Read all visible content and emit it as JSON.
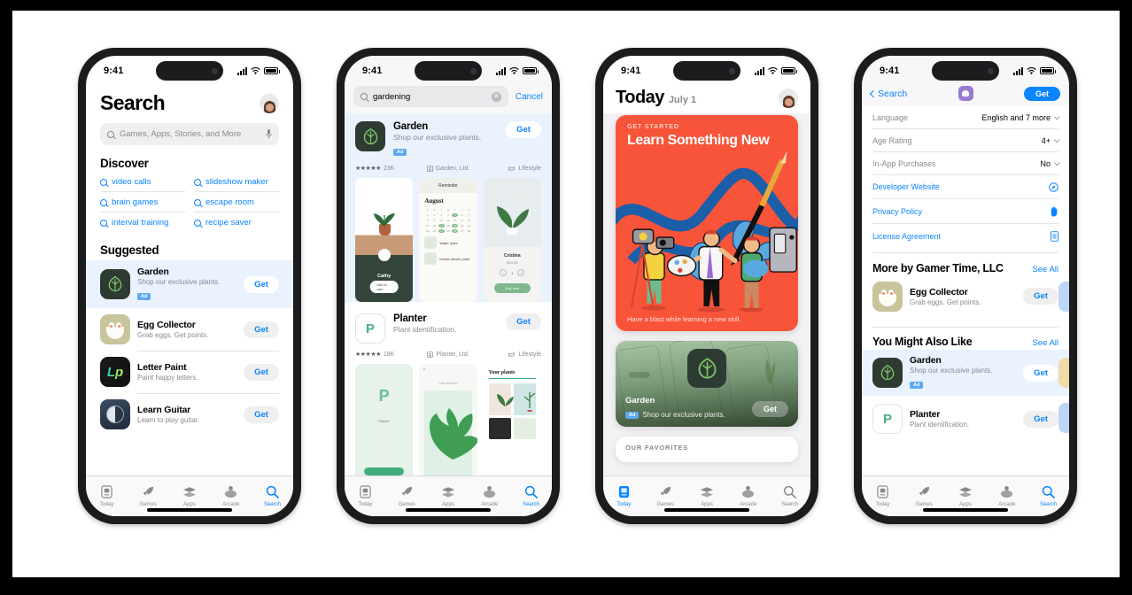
{
  "status_bar": {
    "time": "9:41"
  },
  "tabs": [
    {
      "label": "Today",
      "icon": "today-icon"
    },
    {
      "label": "Games",
      "icon": "games-icon"
    },
    {
      "label": "Apps",
      "icon": "apps-icon"
    },
    {
      "label": "Arcade",
      "icon": "arcade-icon"
    },
    {
      "label": "Search",
      "icon": "search-icon"
    }
  ],
  "colors": {
    "accent": "#0a84ff",
    "ad_badge": "#5ca9f5",
    "ad_row_bg": "#e9f2fe",
    "hero_bg": "#f8543a",
    "garden_icon_bg": "#2e3b32",
    "garden_leaf": "#7dc86a"
  },
  "phone1": {
    "title": "Search",
    "avatar": "avatar",
    "search": {
      "placeholder": "Games, Apps, Stories, and More",
      "mic_icon": "microphone-icon"
    },
    "discover": {
      "heading": "Discover",
      "items": [
        "video calls",
        "slideshow maker",
        "brain games",
        "escape room",
        "interval training",
        "recipe saver"
      ]
    },
    "suggested": {
      "heading": "Suggested",
      "apps": [
        {
          "name": "Garden",
          "subtitle": "Shop our exclusive plants.",
          "badge": "Ad",
          "action": "Get",
          "icon": "garden-icon"
        },
        {
          "name": "Egg Collector",
          "subtitle": "Grab eggs. Get points.",
          "badge": "",
          "action": "Get",
          "icon": "egg-collector-icon"
        },
        {
          "name": "Letter Paint",
          "subtitle": "Paint happy letters.",
          "badge": "",
          "action": "Get",
          "icon": "letter-paint-icon"
        },
        {
          "name": "Learn Guitar",
          "subtitle": "Learn to play guitar.",
          "badge": "",
          "action": "Get",
          "icon": "learn-guitar-icon"
        }
      ]
    }
  },
  "phone2": {
    "search": {
      "value": "gardening",
      "clear": "✕",
      "cancel": "Cancel"
    },
    "results": [
      {
        "name": "Garden",
        "subtitle": "Shop our exclusive plants.",
        "badge": "Ad",
        "action": "Get",
        "stars": "★★★★★",
        "ratings": "23K",
        "developer": "Garden, Ltd.",
        "category": "Lifestyle",
        "icon": "garden-icon"
      },
      {
        "name": "Planter",
        "subtitle": "Plant identification.",
        "badge": "",
        "action": "Get",
        "stars": "★★★★★",
        "ratings": "18K",
        "developer": "Planter, Ltd.",
        "category": "Lifestyle",
        "icon": "planter-icon"
      }
    ],
    "screenshot_captions": {
      "shot1_label": "Cathy",
      "shot1_button": "Add to cart",
      "shot2_title": "Reminder",
      "shot2_month": "August",
      "shot2_row1": "Water plant",
      "shot2_row2": "Dahlia dieses plant",
      "shot3_title": "Cristina",
      "shot3_price": "$15.99",
      "shot3_button": "Buy now",
      "shot4_title": "Your plants"
    }
  },
  "phone3": {
    "title": "Today",
    "date": "July 1",
    "avatar": "avatar",
    "hero": {
      "kicker": "GET STARTED",
      "title": "Learn Something New",
      "footer": "Have a blast while learning a new skill."
    },
    "garden_card": {
      "name": "Garden",
      "badge": "Ad",
      "subtitle": "Shop our exclusive plants.",
      "action": "Get"
    },
    "favorites": {
      "kicker": "OUR FAVORITES"
    }
  },
  "phone4": {
    "nav": {
      "back": "Search",
      "app_icon": "egg-collector-icon",
      "action": "Get"
    },
    "info_rows": [
      {
        "label": "Language",
        "value": "English and 7 more",
        "type": "disclosure"
      },
      {
        "label": "Age Rating",
        "value": "4+",
        "type": "disclosure"
      },
      {
        "label": "In-App Purchases",
        "value": "No",
        "type": "disclosure"
      },
      {
        "label": "Developer Website",
        "value": "",
        "type": "link",
        "icon": "safari-icon"
      },
      {
        "label": "Privacy Policy",
        "value": "",
        "type": "link",
        "icon": "hand-raised-icon"
      },
      {
        "label": "License Agreement",
        "value": "",
        "type": "link",
        "icon": "document-icon"
      }
    ],
    "sections": [
      {
        "title": "More by Gamer Time, LLC",
        "see_all": "See All",
        "apps": [
          {
            "name": "Egg Collector",
            "subtitle": "Grab eggs. Get points.",
            "badge": "",
            "action": "Get",
            "icon": "egg-collector-icon"
          }
        ]
      },
      {
        "title": "You Might Also Like",
        "see_all": "See All",
        "apps": [
          {
            "name": "Garden",
            "subtitle": "Shop our exclusive plants.",
            "badge": "Ad",
            "action": "Get",
            "icon": "garden-icon"
          },
          {
            "name": "Planter",
            "subtitle": "Plant identification.",
            "badge": "",
            "action": "Get",
            "icon": "planter-icon"
          }
        ]
      }
    ]
  }
}
